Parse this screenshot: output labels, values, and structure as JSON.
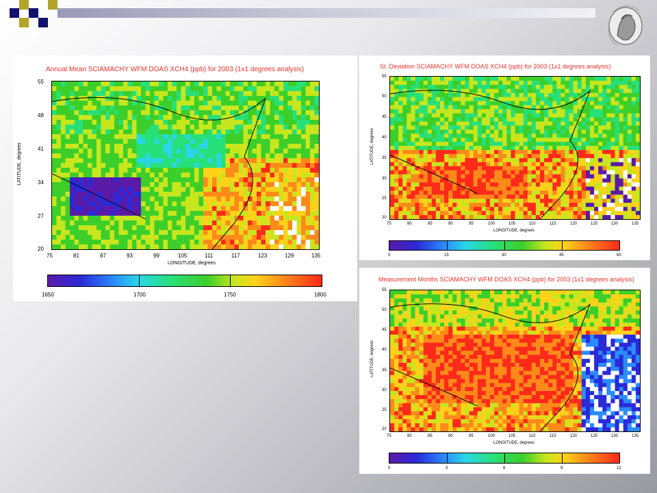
{
  "header": {
    "squares": [
      {
        "color": "#11116e"
      },
      {
        "color": "#b3a42a"
      },
      {
        "color": "#b3a42a"
      },
      {
        "color": "#11116e"
      },
      {
        "color": "#ffffff"
      },
      {
        "color": "#11116e"
      },
      {
        "color": "#b3a42a"
      },
      {
        "color": "#ffffff"
      }
    ],
    "seal_icon": "university-seal-icon"
  },
  "maps": [
    {
      "id": "annual-mean",
      "title": "Annual Mean SCIAMACHY WFM DOAS XCH4 (ppb) for 2003 (1x1 degrees analysis)",
      "ylabel": "LATITUDE, degrees",
      "xlabel": "LONGITUDE, degrees",
      "lat_ticks": [
        "55",
        "48",
        "41",
        "34",
        "27",
        "20"
      ],
      "lon_ticks": [
        "75",
        "81",
        "87",
        "93",
        "99",
        "105",
        "111",
        "117",
        "123",
        "129",
        "135"
      ],
      "colorbar_ticks": [
        "1650",
        "1700",
        "1750",
        "1800"
      ]
    },
    {
      "id": "std-deviation",
      "title": "St. Deviation SCIAMACHY WFM DOAS XCH4 (ppb) for 2003 (1x1 degrees analysis)",
      "ylabel": "LATITUDE, degrees",
      "xlabel": "LONGITUDE, degrees",
      "lat_ticks": [
        "55",
        "50",
        "45",
        "40",
        "35",
        "30",
        "25",
        "20"
      ],
      "lon_ticks": [
        "75",
        "80",
        "85",
        "90",
        "95",
        "100",
        "105",
        "110",
        "115",
        "120",
        "125",
        "130",
        "135"
      ],
      "colorbar_ticks": [
        "0",
        "15",
        "30",
        "45",
        "60"
      ]
    },
    {
      "id": "measurement-months",
      "title": "Measurement Months SCIAMACHY WFM DOAS XCH4 (ppb) for 2003 (1x1 degrees analysis)",
      "ylabel": "LATITUDE, degrees",
      "xlabel": "LONGITUDE, degrees",
      "lat_ticks": [
        "55",
        "50",
        "45",
        "40",
        "35",
        "30",
        "25",
        "20"
      ],
      "lon_ticks": [
        "75",
        "80",
        "85",
        "90",
        "95",
        "100",
        "105",
        "110",
        "115",
        "120",
        "125",
        "130",
        "135"
      ],
      "colorbar_ticks": [
        "0",
        "3",
        "6",
        "9",
        "12"
      ]
    }
  ]
}
